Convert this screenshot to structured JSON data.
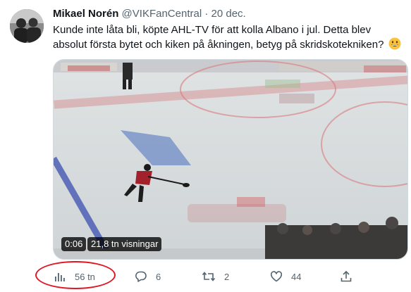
{
  "tweet": {
    "author_name": "Mikael Norén",
    "author_handle": "@VIKFanCentral",
    "separator": "·",
    "date": "20 dec.",
    "text": "Kunde inte låta bli, köpte AHL-TV för att kolla Albano i jul. Detta blev absolut första bytet och kiken på åkningen, betyg på skridskotekniken?",
    "emoji": "grinning-face-emoji"
  },
  "video": {
    "time": "0:06",
    "views": "21,8 tn visningar"
  },
  "actions": {
    "views": "56 tn",
    "replies": "6",
    "retweets": "2",
    "likes": "44"
  },
  "annotation": {
    "color": "#e01623"
  }
}
